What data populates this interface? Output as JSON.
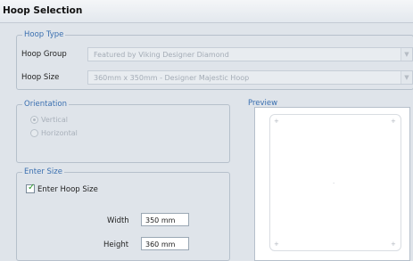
{
  "window": {
    "title": "Hoop Selection"
  },
  "hoop_type": {
    "legend": "Hoop Type",
    "group_label": "Hoop Group",
    "group_value": "Featured by Viking Designer Diamond",
    "size_label": "Hoop Size",
    "size_value": "360mm x 350mm - Designer Majestic Hoop"
  },
  "orientation": {
    "legend": "Orientation",
    "options": [
      "Vertical",
      "Horizontal"
    ]
  },
  "enter_size": {
    "legend": "Enter Size",
    "checkbox_label": "Enter Hoop Size",
    "checked": true,
    "width_label": "Width",
    "width_value": "350 mm",
    "height_label": "Height",
    "height_value": "360 mm"
  },
  "preview": {
    "legend": "Preview"
  },
  "icons": {
    "dropdown": "chevron-down-icon",
    "check": "check-icon",
    "marker": "plus-icon"
  },
  "colors": {
    "accent": "#3a6fb0",
    "check": "#2a9a2a"
  }
}
